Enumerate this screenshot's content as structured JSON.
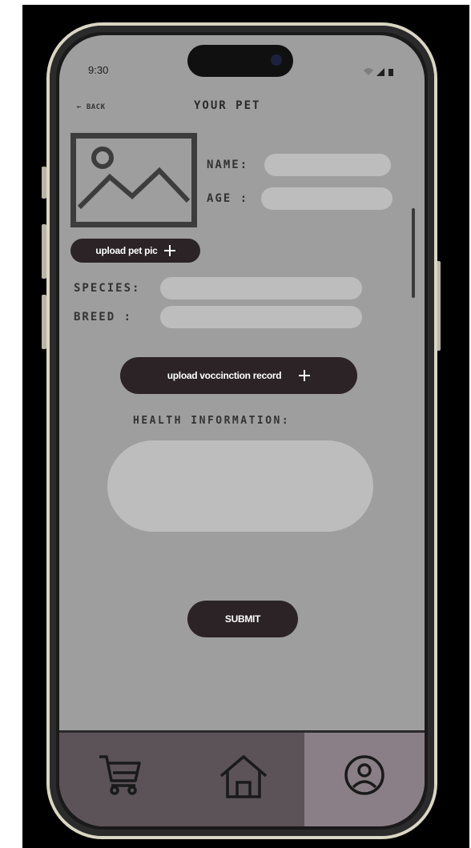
{
  "status_bar": {
    "time": "9:30"
  },
  "header": {
    "back_label": "← BACK",
    "title": "YOUR PET"
  },
  "form": {
    "name_label": "NAME:",
    "age_label": "AGE  :",
    "species_label": "SPECIES:",
    "breed_label": "BREED  :",
    "name_value": "",
    "age_value": "",
    "species_value": "",
    "breed_value": ""
  },
  "buttons": {
    "upload_pet_pic": "upload pet pic",
    "upload_vaccination": "upload voccinction record",
    "submit": "SUBMIT"
  },
  "health": {
    "label": "HEALTH INFORMATION:",
    "value": ""
  },
  "tabbar": {
    "tabs": [
      {
        "icon": "cart-icon",
        "active": false
      },
      {
        "icon": "home-icon",
        "active": false
      },
      {
        "icon": "profile-icon",
        "active": true
      }
    ]
  },
  "colors": {
    "screen_bg": "#9e9e9e",
    "input_bg": "#bdbdbd",
    "button_bg": "#2b2326",
    "tab_bg": "#5b5358",
    "tab_active_bg": "#8a7f86"
  }
}
